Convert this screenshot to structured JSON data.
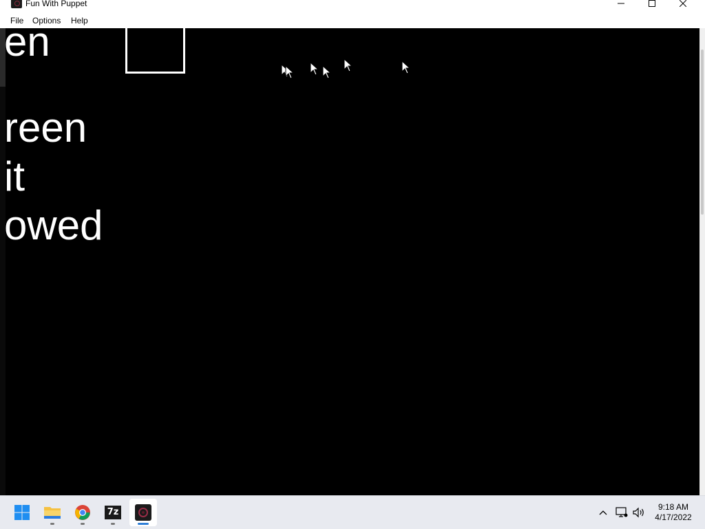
{
  "window": {
    "title": "Fun With Puppet",
    "app_icon": "puppet-app-icon",
    "controls": [
      "minimize-icon",
      "maximize-icon",
      "close-icon"
    ]
  },
  "menu": {
    "items": [
      {
        "label": "File"
      },
      {
        "label": "Options"
      },
      {
        "label": "Help"
      }
    ]
  },
  "canvas": {
    "background": "#000000",
    "text_lines": [
      "en",
      "reen",
      "it",
      "owed"
    ],
    "text_color": "#ffffff",
    "cursor_count": 6
  },
  "taskbar": {
    "apps": [
      {
        "name": "start-icon"
      },
      {
        "name": "file-explorer-icon"
      },
      {
        "name": "chrome-icon"
      },
      {
        "name": "7zip-icon",
        "label": "7z"
      },
      {
        "name": "puppet-app-icon",
        "active": true
      }
    ],
    "tray": [
      "chevron-up-icon",
      "network-icon",
      "volume-icon"
    ],
    "time": "9:18 AM",
    "date": "4/17/2022"
  },
  "colors": {
    "accent": "#2f7fd8",
    "taskbar_bg": "#e8eaf0"
  }
}
